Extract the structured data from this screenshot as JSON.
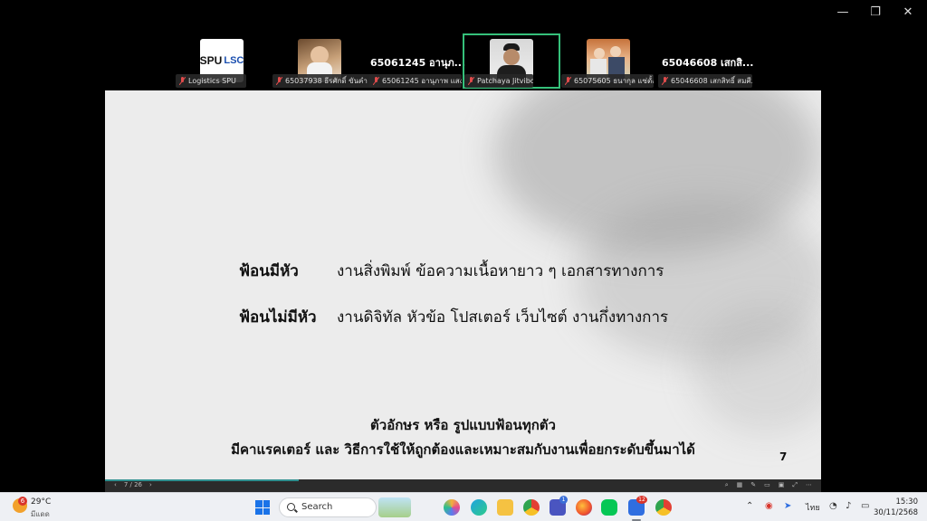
{
  "window": {
    "minimize_icon": "minimize-icon",
    "restore_icon": "restore-icon",
    "close_icon": "close-icon"
  },
  "participants": [
    {
      "name": "Logistics SPU",
      "logo_text_1": "SPU",
      "logo_text_2": "LSC"
    },
    {
      "name": "65037938 ธีรศักดิ์ ขันคำ"
    },
    {
      "name": "65061245 อานุภาพ แสง...",
      "big_label": "65061245 อานุภ..."
    },
    {
      "name": "Patchaya Jitviboon",
      "active": true
    },
    {
      "name": "65075605 ธนากุล แซ่ตั้ง"
    },
    {
      "name": "65046608 เสกสิทธิ์ สมศี...",
      "big_label": "65046608 เสกสิ..."
    }
  ],
  "slide": {
    "rows": [
      {
        "term": "ฟ้อนมีหัว",
        "desc": "งานสิ่งพิมพ์ ข้อความเนื้อหายาว ๆ เอกสารทางการ"
      },
      {
        "term": "ฟ้อนไม่มีหัว",
        "desc": "งานดิจิทัล หัวข้อ โปสเตอร์ เว็บไซต์ งานกึ่งทางการ"
      }
    ],
    "footer_line1": "ตัวอักษร หรือ รูปแบบฟ้อนทุกตัว",
    "footer_line2": "มีคาแรคเตอร์ และ วิธีการใช้ให้ถูกต้องและเหมาะสมกับงานเพื่อยกระดับขึ้นมาได้",
    "page_number": "7"
  },
  "presentation_bar": {
    "page_indicator": "7 / 26",
    "progress_fraction": 0.27
  },
  "taskbar": {
    "weather_temp": "29°C",
    "weather_condition": "มีแดด",
    "weather_badge": "6",
    "search_placeholder": "Search",
    "teams_badge": "1",
    "app_badge": "12",
    "language": "ไทย",
    "time": "15:30",
    "date": "30/11/2568"
  },
  "colors": {
    "active_speaker": "#35c07a",
    "slide_bg": "#ececec",
    "taskbar_bg": "#eef0f4"
  }
}
